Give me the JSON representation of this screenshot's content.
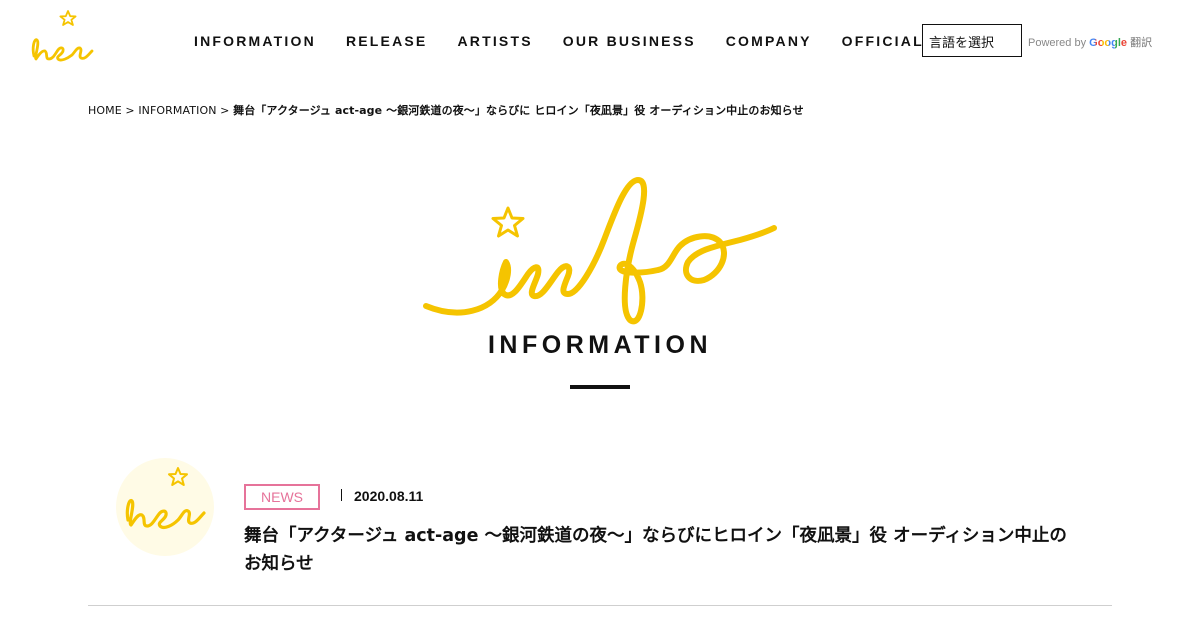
{
  "header": {
    "nav": [
      "INFORMATION",
      "RELEASE",
      "ARTISTS",
      "OUR BUSINESS",
      "COMPANY",
      "OFFICIAL STORE"
    ],
    "language_select": "言語を選択",
    "powered_by": "Powered by",
    "google": "Google",
    "translate": "翻訳"
  },
  "breadcrumb": {
    "home": "HOME",
    "sep1": ">",
    "section": "INFORMATION",
    "sep2": ">",
    "current": "舞台「アクタージュ act-age ～銀河鉄道の夜～」ならびに ヒロイン「夜凪景」役 オーディション中止のお知らせ"
  },
  "hero": {
    "title": "INFORMATION"
  },
  "entry": {
    "tag": "NEWS",
    "date": "2020.08.11",
    "title": "舞台「アクタージュ act-age ～銀河鉄道の夜～」ならびにヒロイン「夜凪景」役 オーディション中止のお知らせ"
  },
  "colors": {
    "accent_yellow": "#f5c400",
    "tag_pink": "#e6739a",
    "text": "#111111"
  },
  "icons": {
    "logo": "handwritten-he-star-logo",
    "hero": "handwritten-info-star"
  }
}
